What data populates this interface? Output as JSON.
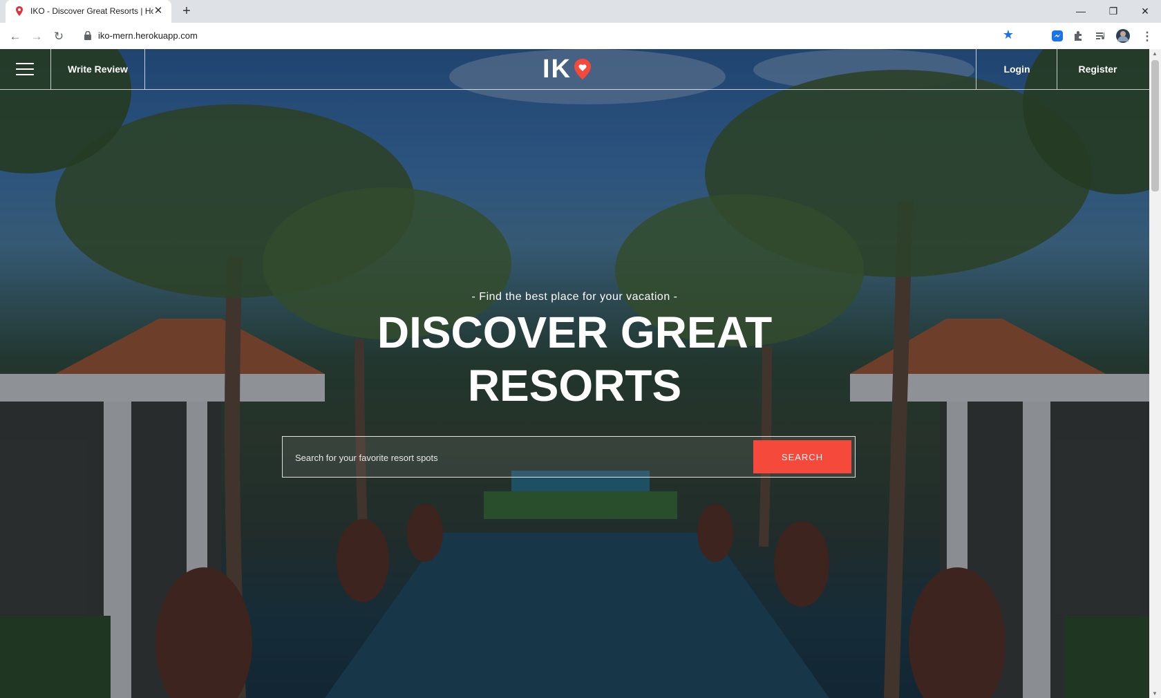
{
  "browser": {
    "tab_title": "IKO - Discover Great Resorts | Ho",
    "url": "iko-mern.herokuapp.com",
    "new_tab": "+",
    "tab_close": "✕",
    "minimize": "—",
    "restore": "❐",
    "close": "✕"
  },
  "site": {
    "nav": {
      "write_review": "Write Review",
      "logo_text": "IK",
      "login": "Login",
      "register": "Register"
    },
    "hero": {
      "tagline": "- Find the best place for your vacation -",
      "headline": "DISCOVER GREAT RESORTS",
      "search_placeholder": "Search for your favorite resort spots",
      "search_button": "SEARCH"
    }
  },
  "colors": {
    "accent": "#f4493b",
    "chrome_bar": "#dee1e6"
  }
}
